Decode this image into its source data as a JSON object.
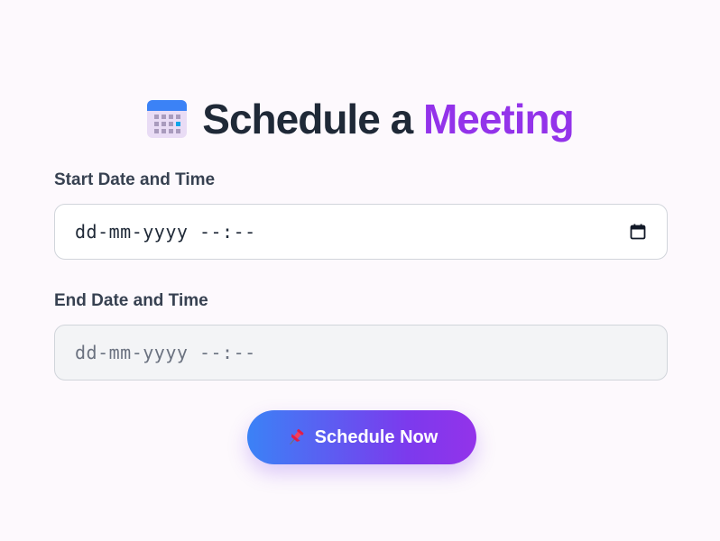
{
  "header": {
    "icon": "calendar-icon",
    "title_main": "Schedule a",
    "title_accent": "Meeting",
    "accent_color": "#9333ea"
  },
  "form": {
    "start": {
      "label": "Start Date and Time",
      "placeholder": "dd-mm-yyyy --:--",
      "picker_icon": "calendar-picker-icon"
    },
    "end": {
      "label": "End Date and Time",
      "placeholder": "dd-mm-yyyy --:--",
      "disabled": true
    }
  },
  "submit": {
    "icon": "pushpin-icon",
    "label": "Schedule Now",
    "gradient_start": "#3b82f6",
    "gradient_end": "#9333ea"
  }
}
